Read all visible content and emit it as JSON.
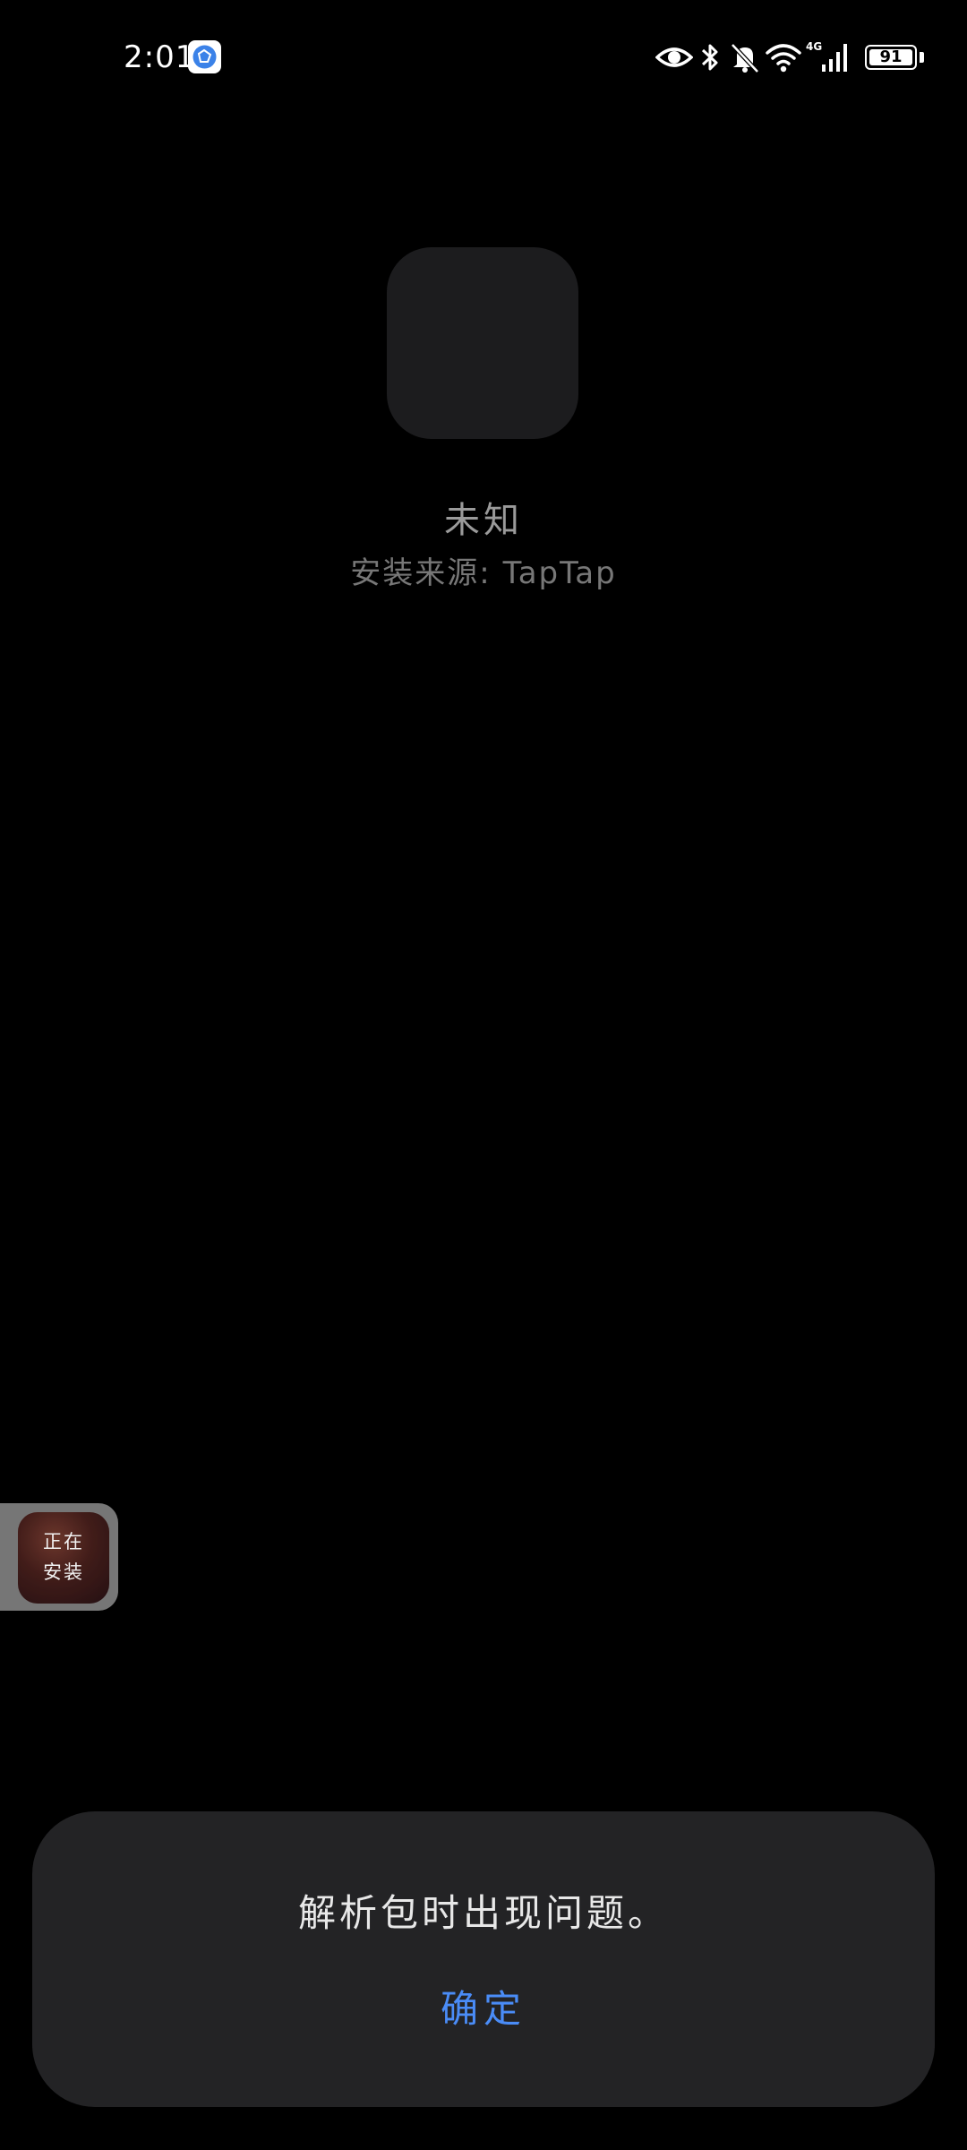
{
  "status_bar": {
    "time": "2:01",
    "battery_level": "91",
    "network_type": "4G",
    "icons": [
      "eye-comfort-icon",
      "bluetooth-icon",
      "mute-icon",
      "wifi-icon",
      "cellular-signal-icon",
      "battery-icon"
    ]
  },
  "app": {
    "name": "未知",
    "source_label": "安装来源:",
    "source_value": "TapTap"
  },
  "floating_install": {
    "line1": "正在",
    "line2": "安装"
  },
  "dialog": {
    "message": "解析包时出现问题。",
    "confirm_label": "确定"
  },
  "colors": {
    "background": "#000000",
    "dialog_background": "#232325",
    "accent": "#4a8cf7",
    "icon_placeholder": "#1c1c1e"
  }
}
